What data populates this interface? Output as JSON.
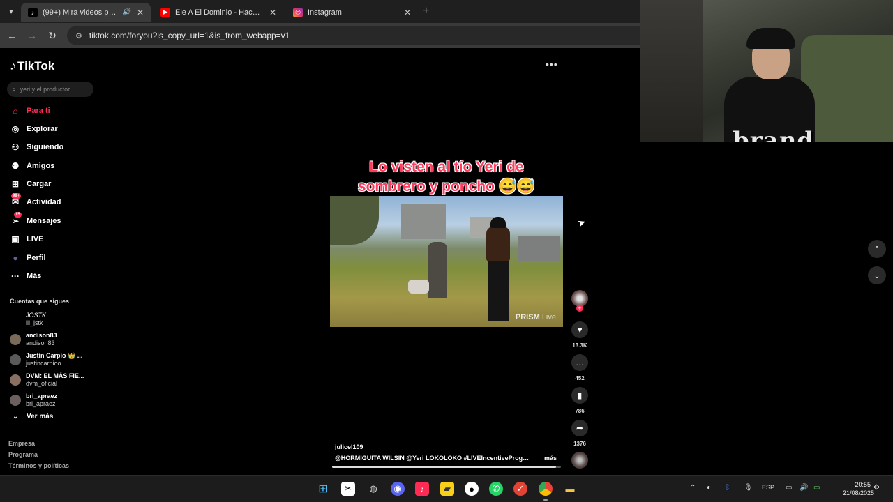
{
  "browser": {
    "tabs": [
      {
        "title": "(99+) Mira videos populares",
        "active": true,
        "favicon": "tiktok-icon"
      },
      {
        "title": "Ele A El Dominio - Hace Mucho",
        "active": false,
        "favicon": "youtube-icon"
      },
      {
        "title": "Instagram",
        "active": false,
        "favicon": "instagram-icon"
      }
    ],
    "url": "tiktok.com/foryou?is_copy_url=1&is_from_webapp=v1"
  },
  "webcam": {
    "brand_text": "brand"
  },
  "sidebar": {
    "logo": "TikTok",
    "search_placeholder": "yeri y el productor",
    "nav": [
      {
        "label": "Para ti",
        "icon": "home-icon"
      },
      {
        "label": "Explorar",
        "icon": "compass-icon"
      },
      {
        "label": "Siguiendo",
        "icon": "following-icon"
      },
      {
        "label": "Amigos",
        "icon": "friends-icon"
      },
      {
        "label": "Cargar",
        "icon": "upload-icon"
      },
      {
        "label": "Actividad",
        "icon": "activity-icon",
        "badge": "99+"
      },
      {
        "label": "Mensajes",
        "icon": "messages-icon",
        "badge": "15"
      },
      {
        "label": "LIVE",
        "icon": "live-icon"
      },
      {
        "label": "Perfil",
        "icon": "profile-icon"
      },
      {
        "label": "Más",
        "icon": "more-icon"
      }
    ],
    "following_heading": "Cuentas que sigues",
    "accounts": [
      {
        "name": "JOSTK",
        "handle": "lil_jstk"
      },
      {
        "name": "andison83",
        "handle": "andison83"
      },
      {
        "name": "Justin Carpio 👑 ...",
        "handle": "justincarpioo"
      },
      {
        "name": "DVM: EL MÁS FIE...",
        "handle": "dvm_oficial"
      },
      {
        "name": "bri_apraez",
        "handle": "bri_apraez"
      }
    ],
    "see_more": "Ver más",
    "footer": [
      "Empresa",
      "Programa",
      "Términos y políticas"
    ]
  },
  "video": {
    "caption_line1": "Lo visten al tío Yeri de",
    "caption_line2": "sombrero y poncho 😅😅",
    "watermark_brand": "PRISM",
    "watermark_suffix": "Live",
    "author": "julicel109",
    "description": "@HORMIGUITA WILSIN  @Yeri LOKOLOKO  #LIVEIncentiveProgram ...",
    "more_label": "más",
    "progress": 0.98
  },
  "actions": {
    "likes": "13.3K",
    "comments": "452",
    "saves": "786",
    "shares": "1376"
  },
  "taskbar": {
    "lang": "ESP",
    "time": "20:55",
    "date": "21/08/2025"
  },
  "colors": {
    "accent": "#fe2c55",
    "background": "#000000",
    "taskbar": "#1c1c1c"
  }
}
